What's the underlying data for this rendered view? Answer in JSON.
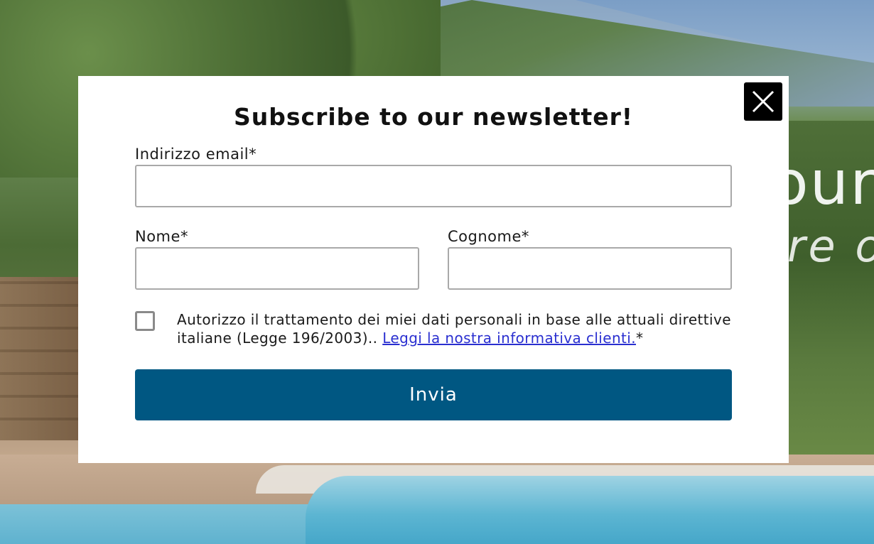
{
  "background": {
    "heading_large": "our",
    "heading_italic": "re o"
  },
  "modal": {
    "title": "Subscribe to our newsletter!",
    "close_icon": "close-icon",
    "email": {
      "label": "Indirizzo email",
      "required_mark": "*",
      "value": "",
      "placeholder": ""
    },
    "first_name": {
      "label": "Nome",
      "required_mark": "*",
      "value": "",
      "placeholder": ""
    },
    "last_name": {
      "label": "Cognome",
      "required_mark": "*",
      "value": "",
      "placeholder": ""
    },
    "consent": {
      "checked": false,
      "text": "Autorizzo il trattamento dei miei dati personali in base alle attuali direttive italiane (Legge 196/2003).. ",
      "link_text": "Leggi la nostra informativa clienti.",
      "required_mark": "*"
    },
    "submit_label": "Invia"
  },
  "colors": {
    "submit_background": "#005782",
    "link": "#2a2fd0",
    "close_background": "#000000"
  }
}
